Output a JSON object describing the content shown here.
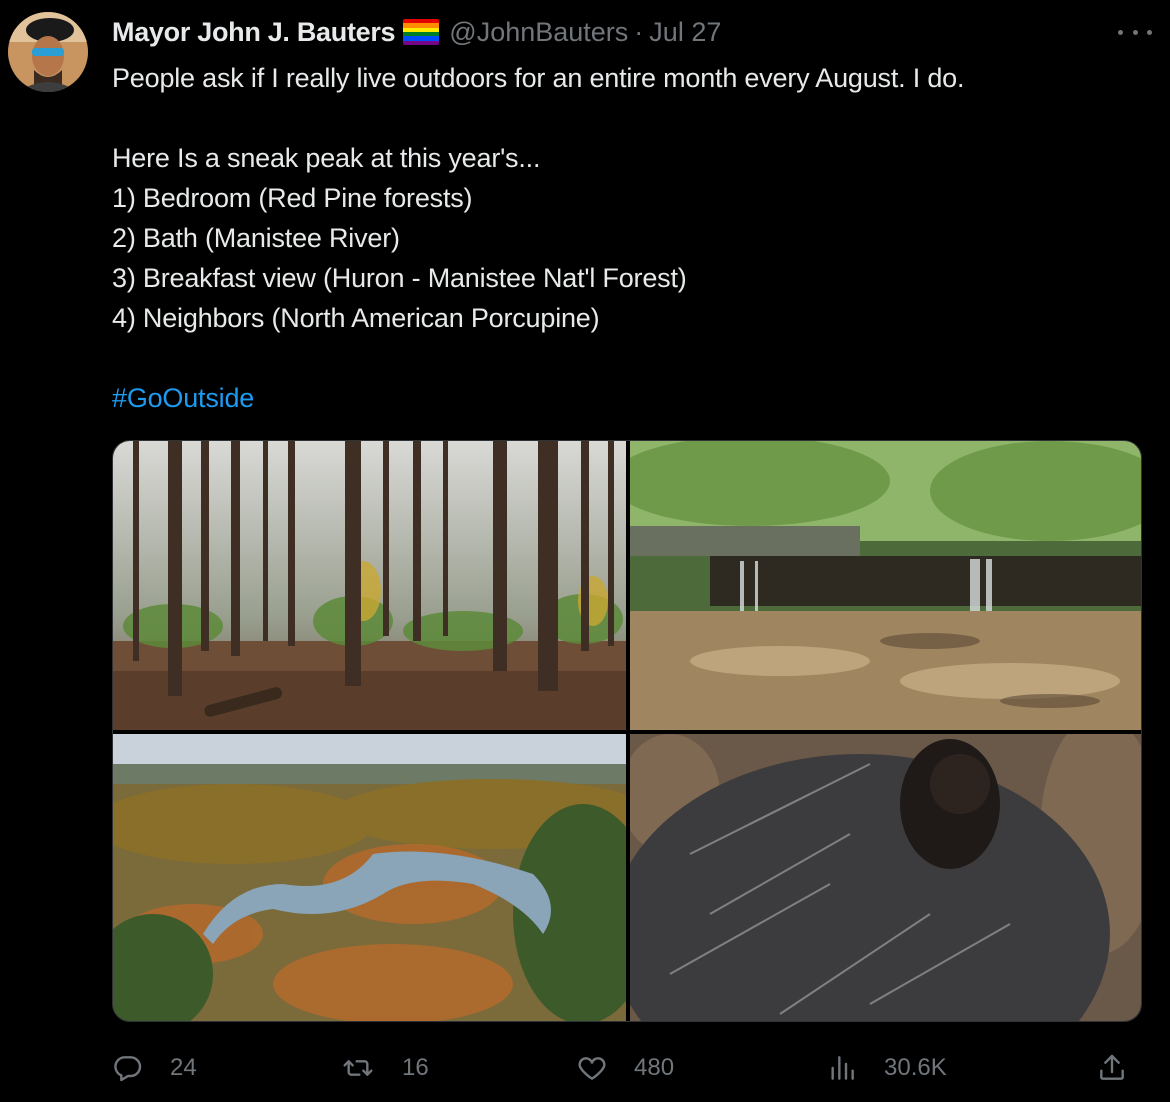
{
  "tweet": {
    "author_name": "Mayor John J. Bauters",
    "handle": "@JohnBauters",
    "separator": "·",
    "date": "Jul 27",
    "text_lines": [
      "People ask if I really live outdoors for an entire month every August. I do.",
      "Here Is a sneak peak at this year's...",
      "1) Bedroom (Red Pine forests)",
      "2) Bath (Manistee River)",
      "3) Breakfast view (Huron - Manistee Nat'l Forest)",
      "4) Neighbors (North American Porcupine)"
    ],
    "hashtag": "#GoOutside"
  },
  "media": [
    {
      "name": "forest-photo"
    },
    {
      "name": "waterfall-photo"
    },
    {
      "name": "river-valley-photo"
    },
    {
      "name": "porcupine-photo"
    }
  ],
  "actions": {
    "replies": "24",
    "retweets": "16",
    "likes": "480",
    "views": "30.6K"
  },
  "icons": {
    "reply": "reply-icon",
    "retweet": "retweet-icon",
    "like": "heart-icon",
    "views": "views-icon",
    "share": "share-icon",
    "more": "more-icon"
  },
  "colors": {
    "background": "#000000",
    "text": "#e7e9ea",
    "secondary": "#71767b",
    "link": "#1d9bf0"
  }
}
